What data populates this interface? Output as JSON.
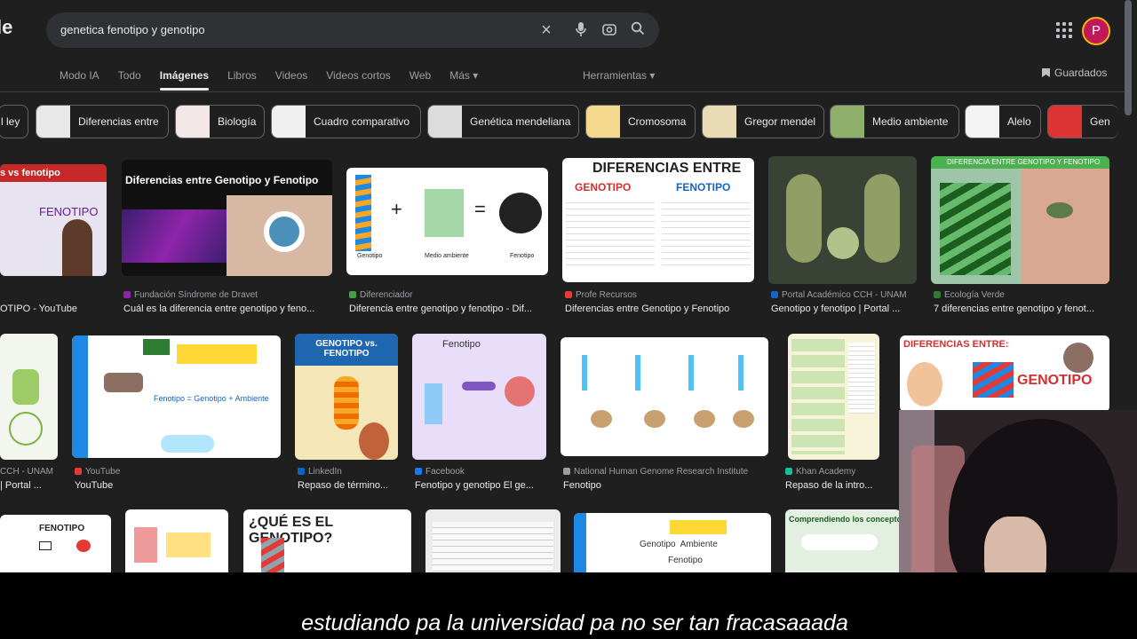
{
  "logo_fragment": "le",
  "search": {
    "query": "genetica fenotipo y genotipo",
    "clear_icon": "close-icon",
    "voice_icon": "mic-icon",
    "lens_icon": "camera-lens-icon",
    "search_icon": "search-icon"
  },
  "account": {
    "initial": "P",
    "color": "#c2185b"
  },
  "tabs": [
    "Modo IA",
    "Todo",
    "Imágenes",
    "Libros",
    "Videos",
    "Videos cortos",
    "Web",
    "Más ▾"
  ],
  "active_tab": "Imágenes",
  "tools_label": "Herramientas ▾",
  "saved_label": "Guardados",
  "chips": [
    {
      "label": "l ley"
    },
    {
      "label": "Diferencias entre"
    },
    {
      "label": "Biología"
    },
    {
      "label": "Cuadro comparativo"
    },
    {
      "label": "Genética mendeliana"
    },
    {
      "label": "Cromosoma"
    },
    {
      "label": "Gregor mendel"
    },
    {
      "label": "Medio ambiente"
    },
    {
      "label": "Alelo"
    },
    {
      "label": "Gen"
    }
  ],
  "results": [
    {
      "source": "",
      "title": "OTIPO - YouTube",
      "img_text": "s vs fenotipo",
      "img_text2": "FENOTIPO"
    },
    {
      "source": "Fundación Síndrome de Dravet",
      "title": "Cuál es la diferencia entre genotipo y feno...",
      "img_text": "Diferencias entre Genotipo y Fenotipo"
    },
    {
      "source": "Diferenciador",
      "title": "Diferencia entre genotipo y fenotipo - Dif...",
      "img_text": "+",
      "img_text2": "=",
      "cap1": "Genotipo",
      "cap2": "Medio ambiente",
      "cap3": "Fenotipo"
    },
    {
      "source": "Profe Recursos",
      "title": "Diferencias entre Genotipo y Fenotipo",
      "img_text": "DIFERENCIAS ENTRE",
      "img_text2": "GENOTIPO",
      "img_text3": "FENOTIPO"
    },
    {
      "source": "Portal Académico CCH - UNAM",
      "title": "Genotipo y fenotipo | Portal ..."
    },
    {
      "source": "Ecología Verde",
      "title": "7 diferencias entre genotipo y fenot...",
      "img_text": "DIFERENCIA ENTRE GENOTIPO Y FENOTIPO"
    },
    {
      "source": "CCH - UNAM",
      "title": "| Portal ..."
    },
    {
      "source": "YouTube",
      "title": "YouTube",
      "img_text": "Fenotipo = Genotipo + Ambiente"
    },
    {
      "source": "LinkedIn",
      "title": "Repaso de término...",
      "img_text": "GENOTIPO vs. FENOTIPO"
    },
    {
      "source": "Facebook",
      "title": "Fenotipo y genotipo El ge...",
      "img_text": "Fenotipo"
    },
    {
      "source": "National Human Genome Research Institute",
      "title": "Fenotipo"
    },
    {
      "source": "Khan Academy",
      "title": "Repaso de la intro..."
    },
    {
      "source": "",
      "title": "",
      "img_text": "DIFERENCIAS ENTRE:",
      "img_text2": "GENOTIPO"
    },
    {
      "img_text": "FENOTIPO"
    },
    {
      "img_text": ""
    },
    {
      "img_text": "¿QUÉ ES EL GENOTIPO?"
    },
    {
      "img_text": ""
    },
    {
      "img_text": "Genotipo  Ambiente",
      "img_text2": "Fenotipo"
    },
    {
      "img_text": "Comprendiendo los conceptos de"
    }
  ],
  "subtitle": "estudiando pa la universidad pa no ser tan fracasaaada"
}
